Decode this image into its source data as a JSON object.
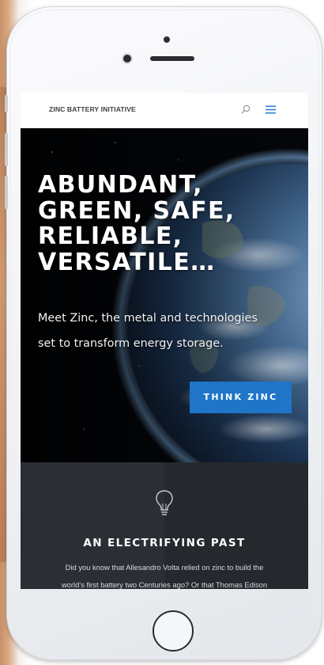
{
  "header": {
    "brand": "ZINC BATTERY INITIATIVE",
    "search_icon": "search-icon",
    "menu_icon": "hamburger-menu-icon",
    "accent_color": "#2d7fd0"
  },
  "hero": {
    "title_lines": [
      "ABUNDANT,",
      "GREEN, SAFE,",
      "RELIABLE,",
      "VERSATILE…"
    ],
    "subtitle_lines": [
      "Meet Zinc, the metal and technologies",
      "set to transform energy storage."
    ],
    "cta_label": "THINK ZINC",
    "cta_color": "#1f76c8",
    "background_image": "earth-from-space"
  },
  "section": {
    "icon": "lightbulb-icon",
    "title": "AN ELECTRIFYING PAST",
    "body_lines": [
      "Did you know that Allesandro Volta relied on zinc to build the",
      "world’s first battery two Centuries ago?  Or that Thomas Edison"
    ],
    "background_color": "#2b2f35"
  },
  "device": {
    "type": "iphone-white"
  }
}
